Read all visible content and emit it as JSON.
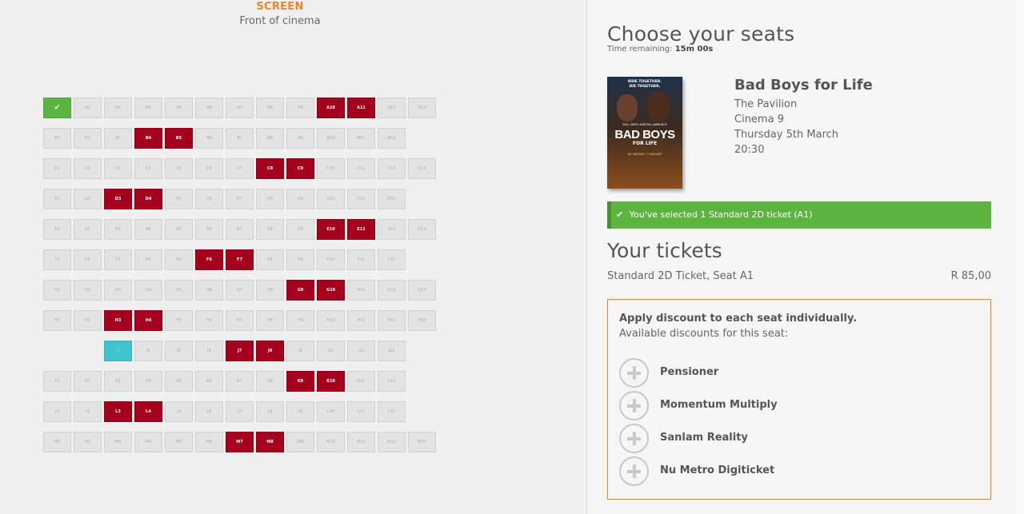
{
  "screen": {
    "label": "SCREEN",
    "sublabel": "Front of cinema"
  },
  "seat_rows": [
    [
      "✔",
      "A2",
      "A3",
      "A4",
      "A5",
      "A6",
      "A7",
      "A8",
      "A9",
      "A10",
      "A11",
      "A12",
      "A13"
    ],
    [
      "B1",
      "B2",
      "B3",
      "B4",
      "B5",
      "B6",
      "B7",
      "B8",
      "B9",
      "B10",
      "B11",
      "B12"
    ],
    [
      "C1",
      "C2",
      "C3",
      "C4",
      "C5",
      "C6",
      "C7",
      "C8",
      "C9",
      "C10",
      "C11",
      "C12",
      "C13"
    ],
    [
      "D1",
      "D2",
      "D3",
      "D4",
      "D5",
      "D6",
      "D7",
      "D8",
      "D9",
      "D10",
      "D11",
      "D12"
    ],
    [
      "E1",
      "E2",
      "E3",
      "E4",
      "E5",
      "E6",
      "E7",
      "E8",
      "E9",
      "E10",
      "E11",
      "E12",
      "E13"
    ],
    [
      "F1",
      "F2",
      "F3",
      "F4",
      "F5",
      "F6",
      "F7",
      "F8",
      "F9",
      "F10",
      "F11",
      "F12"
    ],
    [
      "G1",
      "G2",
      "G3",
      "G4",
      "G5",
      "G6",
      "G7",
      "G8",
      "G9",
      "G10",
      "G11",
      "G12",
      "G13"
    ],
    [
      "H1",
      "H2",
      "H3",
      "H4",
      "H5",
      "H6",
      "H7",
      "H8",
      "H9",
      "H10",
      "H11",
      "H12",
      "H13"
    ],
    [
      "",
      "",
      "J3",
      "J4",
      "J5",
      "J6",
      "J7",
      "J8",
      "J9",
      "J10",
      "J11",
      "J12"
    ],
    [
      "K1",
      "K2",
      "K3",
      "K4",
      "K5",
      "K6",
      "K7",
      "K8",
      "K9",
      "K10",
      "K11",
      "K12"
    ],
    [
      "L1",
      "L2",
      "L3",
      "L4",
      "L5",
      "L6",
      "L7",
      "L8",
      "L9",
      "L10",
      "L11",
      "L12"
    ],
    [
      "M1",
      "M2",
      "M3",
      "M4",
      "M5",
      "M6",
      "M7",
      "M8",
      "M9",
      "M10",
      "M11",
      "M12",
      "M13"
    ]
  ],
  "seats_taken": [
    "A10",
    "A11",
    "B4",
    "B5",
    "C8",
    "C9",
    "D3",
    "D4",
    "E10",
    "E11",
    "F6",
    "F7",
    "G9",
    "G10",
    "H3",
    "H4",
    "J7",
    "J8",
    "K9",
    "K10",
    "L3",
    "L4",
    "M7",
    "M8"
  ],
  "seats_selected": [
    "✔"
  ],
  "seats_wheelchair": [
    "J3"
  ],
  "colors": {
    "taken": "#a5001e",
    "selected": "#5cb541",
    "wheelchair": "#3fc3cc",
    "accent": "#f0822a",
    "available": "#e3e3e3"
  },
  "panel": {
    "title": "Choose your seats",
    "timer_label": "Time remaining:",
    "timer_value": "15m 00s"
  },
  "poster": {
    "tagline_1": "RIDE TOGETHER.",
    "tagline_2": "DIE TOGETHER.",
    "names": "WILL SMITH   MARTIN LAWRENCE",
    "title_1": "BAD BOYS",
    "title_2": "FOR LIFE",
    "date": "IN CINEMAS 17 JANUARY"
  },
  "movie": {
    "title": "Bad Boys for Life",
    "venue": "The Pavilion",
    "cinema": "Cinema 9",
    "date": "Thursday 5th March",
    "time": "20:30"
  },
  "alert": {
    "icon": "check-icon",
    "text": "You've selected 1 Standard 2D ticket (A1)"
  },
  "tickets": {
    "title": "Your tickets",
    "line": "Standard 2D Ticket, Seat A1",
    "price": "R 85,00"
  },
  "discounts": {
    "heading": "Apply discount to each seat individually.",
    "subheading": "Available discounts for this seat:",
    "items": [
      {
        "label": "Pensioner",
        "icon": "plus-circle-icon"
      },
      {
        "label": "Momentum Multiply",
        "icon": "plus-circle-icon"
      },
      {
        "label": "Sanlam Reality",
        "icon": "plus-circle-icon"
      },
      {
        "label": "Nu Metro Digiticket",
        "icon": "plus-circle-icon"
      }
    ]
  }
}
